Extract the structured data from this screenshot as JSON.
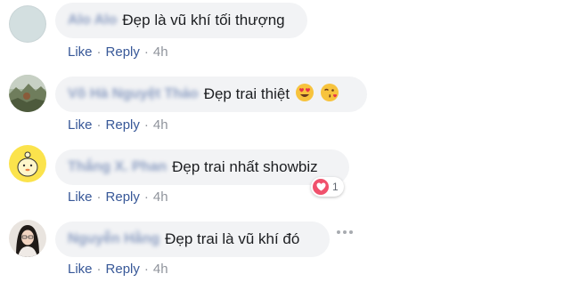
{
  "comments": [
    {
      "author": "Alo Alo",
      "text": "Đẹp là vũ khí tối thượng",
      "like_label": "Like",
      "reply_label": "Reply",
      "time": "4h",
      "avatar": "gray-default-avatar"
    },
    {
      "author": "Võ Hà Nguyệt Thảo",
      "text": "Đẹp trai thiệt",
      "emojis": [
        "heart-eyes-emoji-icon",
        "kissing-face-emoji-icon"
      ],
      "like_label": "Like",
      "reply_label": "Reply",
      "time": "4h",
      "avatar": "landscape-photo-avatar"
    },
    {
      "author": "Thắng X. Phan",
      "text": "Đẹp trai nhất showbiz",
      "like_label": "Like",
      "reply_label": "Reply",
      "time": "4h",
      "avatar": "yellow-cartoon-avatar",
      "reaction": {
        "icon": "heart-icon",
        "count": "1"
      }
    },
    {
      "author": "Nguyễn Hằng",
      "text": "Đẹp trai là vũ khí đó",
      "like_label": "Like",
      "reply_label": "Reply",
      "time": "4h",
      "avatar": "person-photo-avatar"
    }
  ],
  "colors": {
    "link": "#385898",
    "bubble": "#f2f3f5",
    "text": "#1c1e21",
    "meta": "#90949c",
    "heart": "#f0516c"
  }
}
